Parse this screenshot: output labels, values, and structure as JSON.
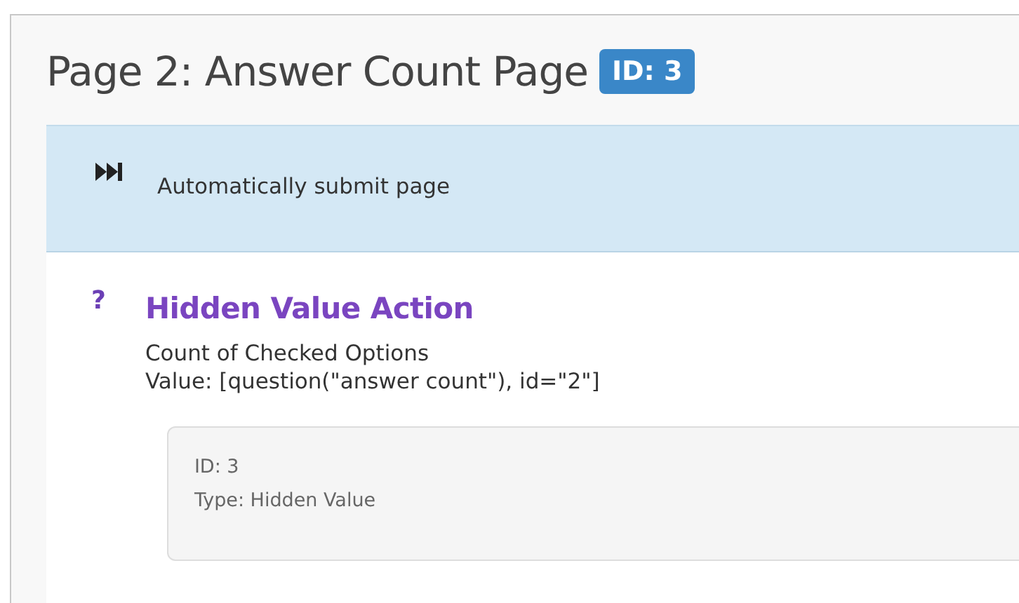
{
  "page": {
    "title": "Page 2: Answer Count Page",
    "id_badge": "ID: 3"
  },
  "auto_submit": {
    "label": "Automatically submit page"
  },
  "action": {
    "icon": "?",
    "title": "Hidden Value Action",
    "description": "Count of Checked Options",
    "value": "Value: [question(\"answer count\"), id=\"2\"]",
    "details": [
      "ID: 3",
      "Type: Hidden Value"
    ]
  }
}
